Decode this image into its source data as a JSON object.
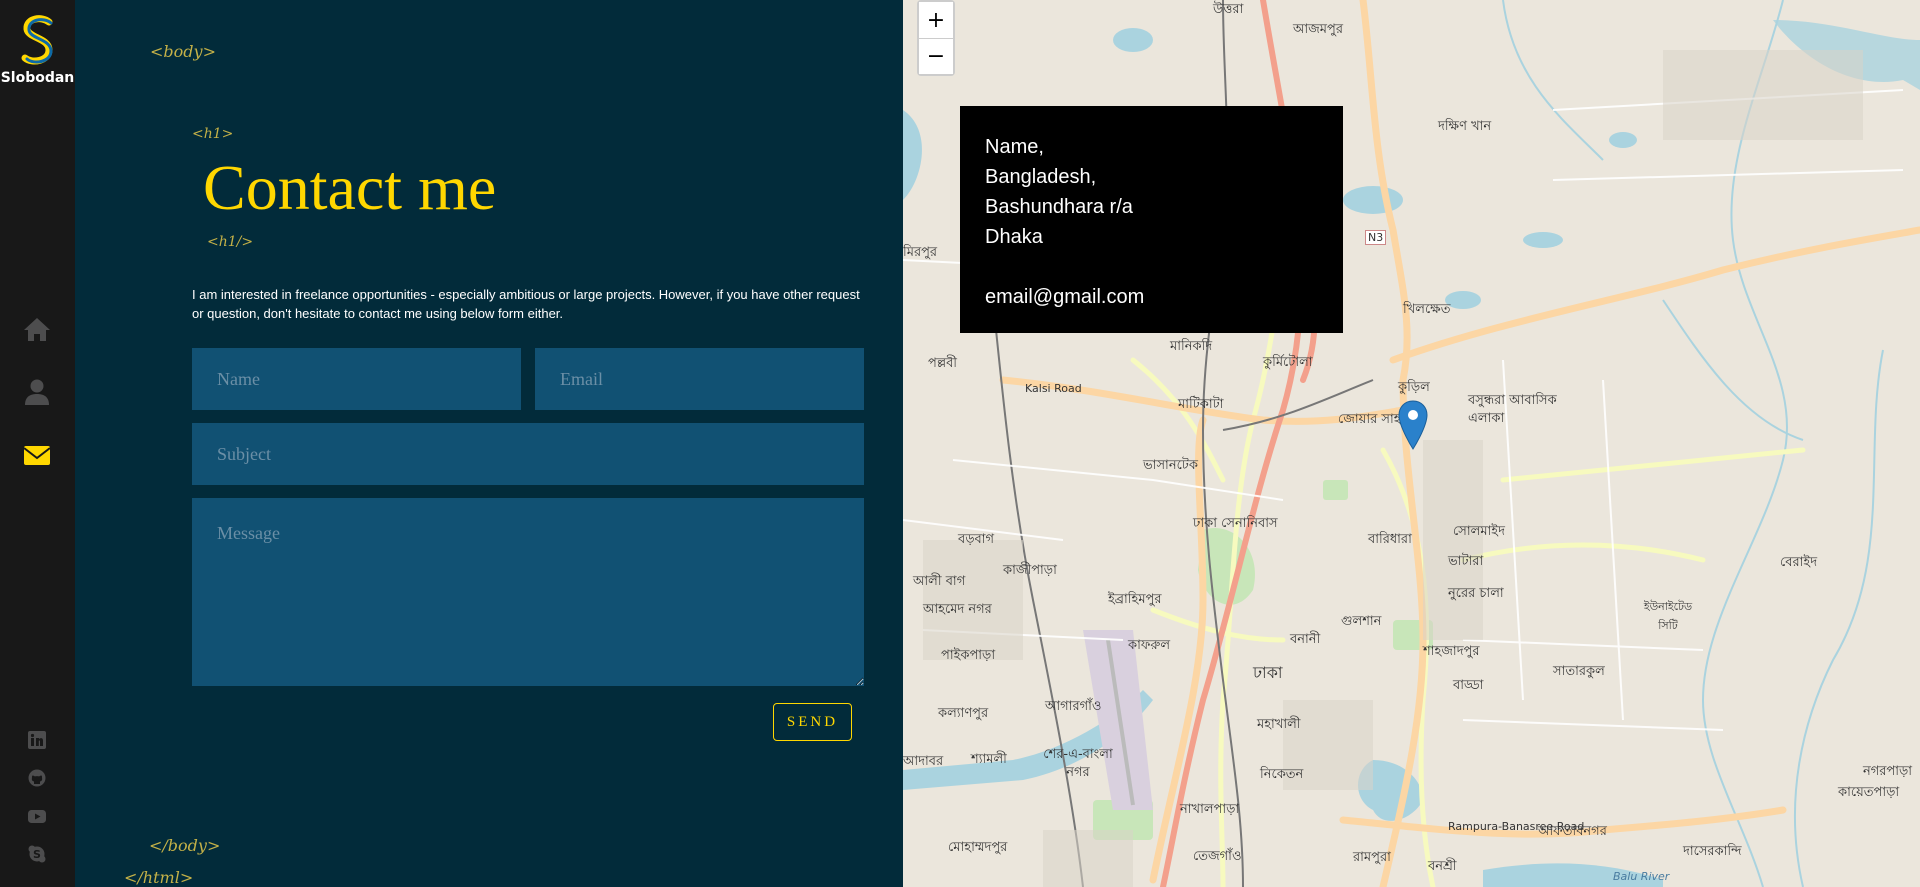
{
  "sidebar": {
    "logo_letter": "S",
    "logo_text": "Slobodan",
    "nav": [
      {
        "name": "home",
        "icon": "home-icon",
        "active": false
      },
      {
        "name": "about",
        "icon": "user-icon",
        "active": false
      },
      {
        "name": "contact",
        "icon": "envelope-icon",
        "active": true
      }
    ],
    "social": [
      {
        "name": "linkedin",
        "icon": "linkedin-icon"
      },
      {
        "name": "github",
        "icon": "github-icon"
      },
      {
        "name": "youtube",
        "icon": "youtube-icon"
      },
      {
        "name": "skype",
        "icon": "skype-icon"
      }
    ],
    "colors": {
      "background": "#181818",
      "icon": "#4d4d4e",
      "active": "#ffd700"
    }
  },
  "tags": {
    "body_open": "<body>",
    "h1_open": "<h1>",
    "h1_close": "<h1/>",
    "body_close": "</body>",
    "html_close": "</html>"
  },
  "contact": {
    "title": "Contact me",
    "intro": "I am interested in freelance opportunities - especially ambitious or large projects. However, if you have other request or question, don't hesitate to contact me using below form either.",
    "form": {
      "name_placeholder": "Name",
      "email_placeholder": "Email",
      "subject_placeholder": "Subject",
      "message_placeholder": "Message",
      "send_label": "SEND"
    },
    "colors": {
      "background": "#022b3a",
      "field": "#115173",
      "accent": "#ffd700"
    }
  },
  "map": {
    "zoom_in": "+",
    "zoom_out": "−",
    "info": {
      "line1": "Name,",
      "line2": "Bangladesh,",
      "line3": "Bashundhara r/a",
      "line4": "Dhaka",
      "email": "email@gmail.com"
    },
    "labels": [
      "উত্তরা",
      "আজমপুর",
      "দক্ষিণ খান",
      "মিরপুর",
      "খিলক্ষেত",
      "পল্লবী",
      "মানিকদি",
      "কুর্মিটোলা",
      "Kalsi Road",
      "মাটিকাটা",
      "কুড়িল",
      "বসুন্ধরা আবাসিক এলাকা",
      "জোয়ার সাহারা",
      "ভাসানটেক",
      "ঢাকা সেনানিবাস",
      "বারিধারা",
      "সোলমাইদ",
      "বড়বাগ",
      "কাজীপাড়া",
      "ভাটারা",
      "বেরাইদ",
      "আলী বাগ",
      "আহমেদ নগর",
      "ইব্রাহিমপুর",
      "নুরের চালা",
      "ইউনাইটেড সিটি",
      "পাইকপাড়া",
      "কাফরুল",
      "বনানী",
      "গুলশান",
      "শাহজাদপুর",
      "ঢাকা",
      "বাড্ডা",
      "সাতারকুল",
      "কল্যাণপুর",
      "আগারগাঁও",
      "মহাখালী",
      "আদাবর",
      "শ্যামলী",
      "শের-এ-বাংলা নগর",
      "নিকেতন",
      "নাখালপাড়া",
      "আফতাবনগর",
      "নগরপাড়া",
      "কায়েতপাড়া",
      "মোহাম্মদপুর",
      "তেজগাঁও",
      "রামপুরা",
      "বনশ্রী",
      "দাসেরকান্দি",
      "Rampura-Banasree Road",
      "Balu River",
      "N3"
    ]
  }
}
